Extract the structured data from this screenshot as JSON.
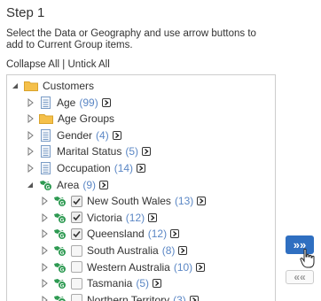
{
  "step": {
    "title": "Step 1"
  },
  "instructions": "Select the Data or Geography and use arrow buttons to add to Current Group items.",
  "links": {
    "collapse": "Collapse All",
    "separator": "|",
    "untick": "Untick All"
  },
  "tree": {
    "root": {
      "label": "Customers",
      "icon": "folder-icon",
      "expanded": true
    },
    "items": [
      {
        "label": "Age",
        "count": "(99)",
        "icon": "document-icon"
      },
      {
        "label": "Age Groups",
        "count": "",
        "icon": "folder-icon"
      },
      {
        "label": "Gender",
        "count": "(4)",
        "icon": "document-icon"
      },
      {
        "label": "Marital Status",
        "count": "(5)",
        "icon": "document-icon"
      },
      {
        "label": "Occupation",
        "count": "(14)",
        "icon": "document-icon"
      },
      {
        "label": "Area",
        "count": "(9)",
        "icon": "geography-icon",
        "expanded": true
      }
    ],
    "area_children": [
      {
        "label": "New South Wales",
        "count": "(13)",
        "checked": true
      },
      {
        "label": "Victoria",
        "count": "(12)",
        "checked": true
      },
      {
        "label": "Queensland",
        "count": "(12)",
        "checked": true
      },
      {
        "label": "South Australia",
        "count": "(8)",
        "checked": false
      },
      {
        "label": "Western Australia",
        "count": "(10)",
        "checked": false
      },
      {
        "label": "Tasmania",
        "count": "(5)",
        "checked": false
      },
      {
        "label": "Northern Territory",
        "count": "(3)",
        "checked": false
      }
    ]
  },
  "buttons": {
    "add_label": "»»",
    "remove_label": "««"
  },
  "colors": {
    "accent": "#2f6fc1",
    "count": "#5b87c5",
    "folder": "#f5c04a"
  }
}
